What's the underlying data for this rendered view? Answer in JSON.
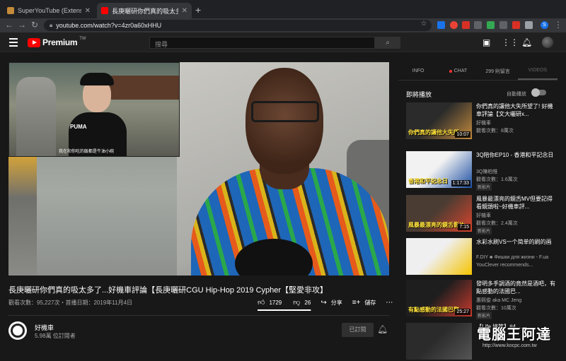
{
  "browser": {
    "tabs": [
      {
        "title": "SuperYouTube (Extension for Yo",
        "favicon_color": "#c48b3a"
      },
      {
        "title": "長庚曬研你們真的吸太多了...好",
        "favicon_color": "#ff0000"
      }
    ],
    "url": "youtube.com/watch?v=4zr0a60xHHU",
    "profile_initial": "S"
  },
  "header": {
    "brand": "Premium",
    "region": "TW",
    "search_placeholder": "搜尋"
  },
  "video": {
    "title": "長庚曬研你們真的吸太多了...好機車評論【長庚曬研CGU Hip-Hop 2019 Cypher【堅愛非攻】",
    "meta": "觀看次數：95,227次・首播日期：2019年11月4日",
    "likes": "1729",
    "dislikes": "26",
    "share_label": "分享",
    "save_label": "儲存",
    "more_label": "⋯",
    "like_ratio": 0.985,
    "inset_sign": "PUMA",
    "inset_subtitle": "我在和你吃的飯都是牛油小碗"
  },
  "channel": {
    "name": "好機車",
    "subs": "5.98萬 位訂閱者",
    "subscribed_label": "已訂閱"
  },
  "sidebar": {
    "tabs": [
      "INFO",
      "CHAT",
      "299 則留言",
      "VIDEOS"
    ],
    "up_next": "即將播放",
    "autoplay": "自動播放",
    "videos": [
      {
        "title": "你們真的讓他大失所望了! 好機車評論【文大曬研x...",
        "channel": "好機車",
        "views": "觀看次數：8萬次",
        "duration": "10:07",
        "overlay": "你們真的讓他大失所",
        "badge": "",
        "color1": "#2b2b2b",
        "color2": "#c38a3d"
      },
      {
        "title": "3Q陪你EP10 - 香港和平記念日",
        "channel": "3Q陳柏惟",
        "views": "觀看次數：1.6萬次",
        "duration": "1:17:33",
        "overlay": "香港和平記念日",
        "badge": "新影片",
        "color1": "#f2f2f2",
        "color2": "#1d4fa3"
      },
      {
        "title": "風暴最漂亮的鏡舌MV但要記得看鏡頭啦~好機車評...",
        "channel": "好機車",
        "views": "觀看次數：2.4萬次",
        "duration": "7:15",
        "overlay": "風暴最漂亮的鏡舌影片",
        "badge": "新影片",
        "color1": "#4a3c32",
        "color2": "#d8442c"
      },
      {
        "title": "水彩水刷VS一个简单的刷的画",
        "channel": "F.DIY ♣ Фишки для жизни - F.ua",
        "views": "YouClever recommends...",
        "duration": "",
        "overlay": "",
        "badge": "",
        "color1": "#efefef",
        "color2": "#f5c400"
      },
      {
        "title": "發明多手調酒的竟然是酒吧，有點感動的法國巴...",
        "channel": "惠熙俊 aka MC Jeng",
        "views": "觀看次數：10萬次",
        "duration": "25:27",
        "overlay": "有點感動的法國巴黎",
        "badge": "新影片",
        "color1": "#1e1e1e",
        "color2": "#c93a2d"
      },
      {
        "title": "【Life 搞笑】#4 ...",
        "channel": "",
        "views": "",
        "duration": "",
        "overlay": "",
        "badge": "",
        "color1": "#2b2b2b",
        "color2": "#555555"
      }
    ]
  },
  "watermark": {
    "text": "電腦王阿達",
    "url": "http://www.kocpc.com.tw"
  },
  "colors": {
    "accent": "#ff0000",
    "background": "#181818"
  }
}
